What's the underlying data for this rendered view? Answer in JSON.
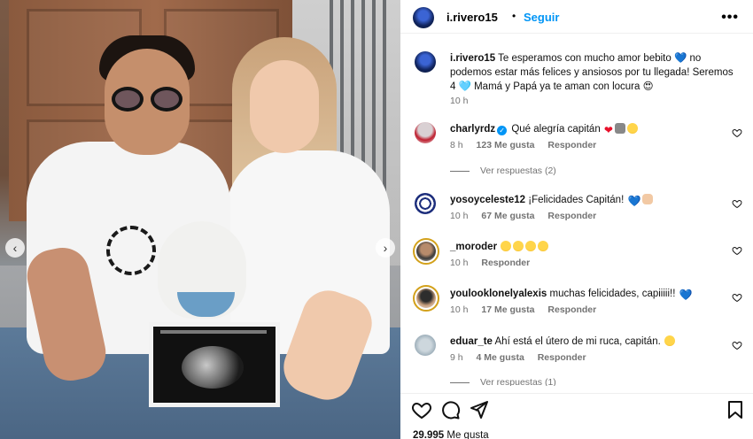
{
  "post": {
    "username": "i.rivero15",
    "follow_label": "Seguir",
    "more_icon": "more-horizontal-icon"
  },
  "caption": {
    "username": "i.rivero15",
    "text": "Te esperamos con mucho amor bebito 💙 no podemos estar más felices y ansiosos por tu llegada! Seremos 4 🩵 Mamá y Papá ya te aman con locura 😍",
    "time": "10 h"
  },
  "comments": [
    {
      "username": "charlyrdz",
      "verified": true,
      "text": "Qué alegría capitán",
      "emoji": [
        "❤",
        "🙏",
        "🥰"
      ],
      "time": "8 h",
      "likes": "123 Me gusta",
      "reply_label": "Responder",
      "view_replies": "Ver respuestas (2)"
    },
    {
      "username": "yosoyceleste12",
      "verified": false,
      "text": "¡Felicidades Capitán!",
      "emoji": [
        "💙",
        "👏"
      ],
      "time": "10 h",
      "likes": "67 Me gusta",
      "reply_label": "Responder"
    },
    {
      "username": "_moroder",
      "verified": false,
      "text": "",
      "emoji": [
        "😍",
        "😍",
        "😍",
        "😍"
      ],
      "time": "10 h",
      "likes": "",
      "reply_label": "Responder"
    },
    {
      "username": "youlooklonelyalexis",
      "verified": false,
      "text": "muchas felicidades, capiiiii!!",
      "emoji": [
        "💙"
      ],
      "time": "10 h",
      "likes": "17 Me gusta",
      "reply_label": "Responder"
    },
    {
      "username": "eduar_te",
      "verified": false,
      "text": "Ahí está el útero de mi ruca, capitán.",
      "emoji": [
        "😍"
      ],
      "time": "9 h",
      "likes": "4 Me gusta",
      "reply_label": "Responder",
      "view_replies": "Ver respuestas (1)"
    }
  ],
  "actions": {
    "like_icon": "heart-icon",
    "comment_icon": "comment-icon",
    "share_icon": "send-icon",
    "save_icon": "bookmark-icon",
    "likes_count": "29.995",
    "likes_label": "Me gusta"
  },
  "carousel": {
    "prev_icon": "chevron-left-icon",
    "next_icon": "chevron-right-icon"
  }
}
